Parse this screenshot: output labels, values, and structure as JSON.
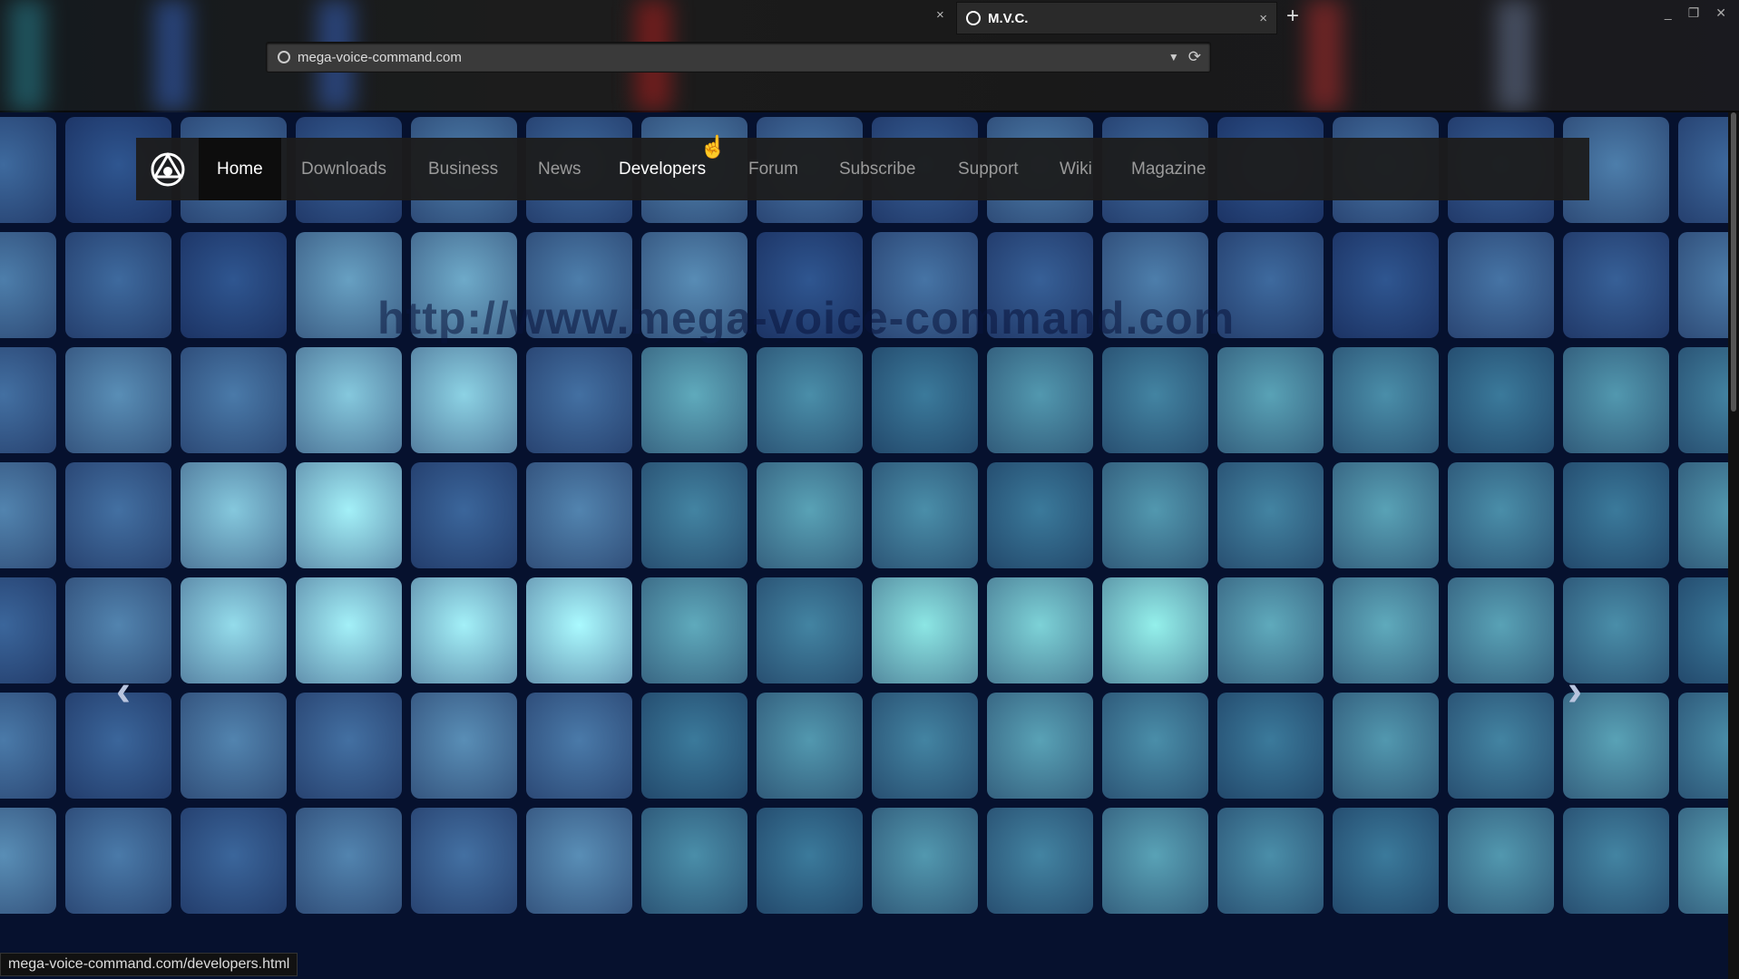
{
  "browser": {
    "tab_title": "M.V.C.",
    "new_tab": "+",
    "close": "×",
    "url": "mega-voice-command.com",
    "status_url": "mega-voice-command.com/developers.html"
  },
  "nav": {
    "items": [
      "Home",
      "Downloads",
      "Business",
      "News",
      "Developers",
      "Forum",
      "Subscribe",
      "Support",
      "Wiki",
      "Magazine"
    ],
    "active": "Home",
    "hovered": "Developers"
  },
  "hero": {
    "watermark": "http://www.mega-voice-command.com",
    "prev": "‹",
    "next": "›"
  }
}
